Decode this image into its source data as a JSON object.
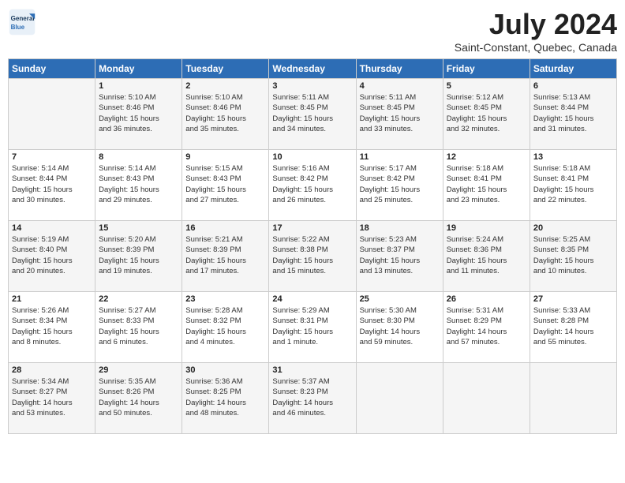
{
  "header": {
    "logo_line1": "General",
    "logo_line2": "Blue",
    "month_title": "July 2024",
    "location": "Saint-Constant, Quebec, Canada"
  },
  "days_of_week": [
    "Sunday",
    "Monday",
    "Tuesday",
    "Wednesday",
    "Thursday",
    "Friday",
    "Saturday"
  ],
  "weeks": [
    [
      {
        "day": "",
        "info": ""
      },
      {
        "day": "1",
        "info": "Sunrise: 5:10 AM\nSunset: 8:46 PM\nDaylight: 15 hours\nand 36 minutes."
      },
      {
        "day": "2",
        "info": "Sunrise: 5:10 AM\nSunset: 8:46 PM\nDaylight: 15 hours\nand 35 minutes."
      },
      {
        "day": "3",
        "info": "Sunrise: 5:11 AM\nSunset: 8:45 PM\nDaylight: 15 hours\nand 34 minutes."
      },
      {
        "day": "4",
        "info": "Sunrise: 5:11 AM\nSunset: 8:45 PM\nDaylight: 15 hours\nand 33 minutes."
      },
      {
        "day": "5",
        "info": "Sunrise: 5:12 AM\nSunset: 8:45 PM\nDaylight: 15 hours\nand 32 minutes."
      },
      {
        "day": "6",
        "info": "Sunrise: 5:13 AM\nSunset: 8:44 PM\nDaylight: 15 hours\nand 31 minutes."
      }
    ],
    [
      {
        "day": "7",
        "info": "Sunrise: 5:14 AM\nSunset: 8:44 PM\nDaylight: 15 hours\nand 30 minutes."
      },
      {
        "day": "8",
        "info": "Sunrise: 5:14 AM\nSunset: 8:43 PM\nDaylight: 15 hours\nand 29 minutes."
      },
      {
        "day": "9",
        "info": "Sunrise: 5:15 AM\nSunset: 8:43 PM\nDaylight: 15 hours\nand 27 minutes."
      },
      {
        "day": "10",
        "info": "Sunrise: 5:16 AM\nSunset: 8:42 PM\nDaylight: 15 hours\nand 26 minutes."
      },
      {
        "day": "11",
        "info": "Sunrise: 5:17 AM\nSunset: 8:42 PM\nDaylight: 15 hours\nand 25 minutes."
      },
      {
        "day": "12",
        "info": "Sunrise: 5:18 AM\nSunset: 8:41 PM\nDaylight: 15 hours\nand 23 minutes."
      },
      {
        "day": "13",
        "info": "Sunrise: 5:18 AM\nSunset: 8:41 PM\nDaylight: 15 hours\nand 22 minutes."
      }
    ],
    [
      {
        "day": "14",
        "info": "Sunrise: 5:19 AM\nSunset: 8:40 PM\nDaylight: 15 hours\nand 20 minutes."
      },
      {
        "day": "15",
        "info": "Sunrise: 5:20 AM\nSunset: 8:39 PM\nDaylight: 15 hours\nand 19 minutes."
      },
      {
        "day": "16",
        "info": "Sunrise: 5:21 AM\nSunset: 8:39 PM\nDaylight: 15 hours\nand 17 minutes."
      },
      {
        "day": "17",
        "info": "Sunrise: 5:22 AM\nSunset: 8:38 PM\nDaylight: 15 hours\nand 15 minutes."
      },
      {
        "day": "18",
        "info": "Sunrise: 5:23 AM\nSunset: 8:37 PM\nDaylight: 15 hours\nand 13 minutes."
      },
      {
        "day": "19",
        "info": "Sunrise: 5:24 AM\nSunset: 8:36 PM\nDaylight: 15 hours\nand 11 minutes."
      },
      {
        "day": "20",
        "info": "Sunrise: 5:25 AM\nSunset: 8:35 PM\nDaylight: 15 hours\nand 10 minutes."
      }
    ],
    [
      {
        "day": "21",
        "info": "Sunrise: 5:26 AM\nSunset: 8:34 PM\nDaylight: 15 hours\nand 8 minutes."
      },
      {
        "day": "22",
        "info": "Sunrise: 5:27 AM\nSunset: 8:33 PM\nDaylight: 15 hours\nand 6 minutes."
      },
      {
        "day": "23",
        "info": "Sunrise: 5:28 AM\nSunset: 8:32 PM\nDaylight: 15 hours\nand 4 minutes."
      },
      {
        "day": "24",
        "info": "Sunrise: 5:29 AM\nSunset: 8:31 PM\nDaylight: 15 hours\nand 1 minute."
      },
      {
        "day": "25",
        "info": "Sunrise: 5:30 AM\nSunset: 8:30 PM\nDaylight: 14 hours\nand 59 minutes."
      },
      {
        "day": "26",
        "info": "Sunrise: 5:31 AM\nSunset: 8:29 PM\nDaylight: 14 hours\nand 57 minutes."
      },
      {
        "day": "27",
        "info": "Sunrise: 5:33 AM\nSunset: 8:28 PM\nDaylight: 14 hours\nand 55 minutes."
      }
    ],
    [
      {
        "day": "28",
        "info": "Sunrise: 5:34 AM\nSunset: 8:27 PM\nDaylight: 14 hours\nand 53 minutes."
      },
      {
        "day": "29",
        "info": "Sunrise: 5:35 AM\nSunset: 8:26 PM\nDaylight: 14 hours\nand 50 minutes."
      },
      {
        "day": "30",
        "info": "Sunrise: 5:36 AM\nSunset: 8:25 PM\nDaylight: 14 hours\nand 48 minutes."
      },
      {
        "day": "31",
        "info": "Sunrise: 5:37 AM\nSunset: 8:23 PM\nDaylight: 14 hours\nand 46 minutes."
      },
      {
        "day": "",
        "info": ""
      },
      {
        "day": "",
        "info": ""
      },
      {
        "day": "",
        "info": ""
      }
    ]
  ]
}
